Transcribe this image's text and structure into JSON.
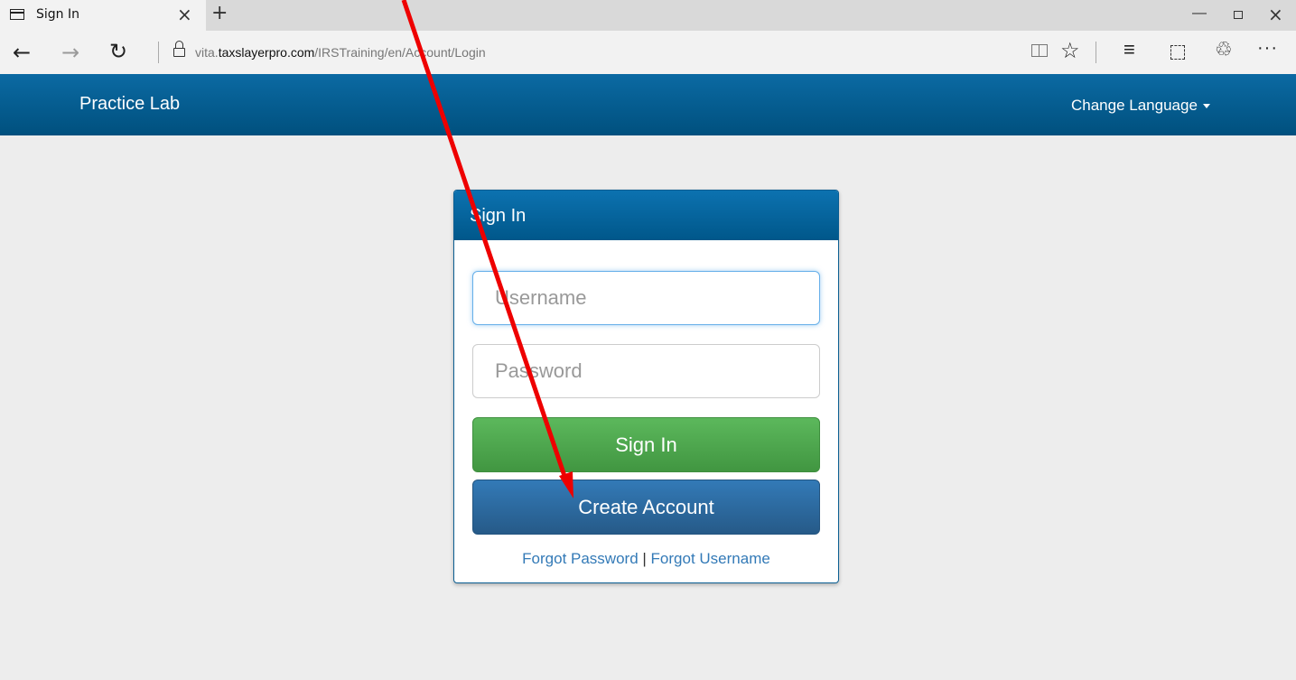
{
  "browser": {
    "tab_title": "Sign In",
    "url_prefix": "vita.",
    "url_domain": "taxslayerpro.com",
    "url_path": "/IRSTraining/en/Account/Login"
  },
  "header": {
    "brand": "Practice Lab",
    "language_menu": "Change Language"
  },
  "signin": {
    "title": "Sign In",
    "username_placeholder": "Username",
    "password_placeholder": "Password",
    "signin_button": "Sign In",
    "create_account_button": "Create Account",
    "forgot_password": "Forgot Password",
    "separator": "|",
    "forgot_username": "Forgot Username"
  },
  "annotation": {
    "arrow_color": "#ee0000"
  }
}
